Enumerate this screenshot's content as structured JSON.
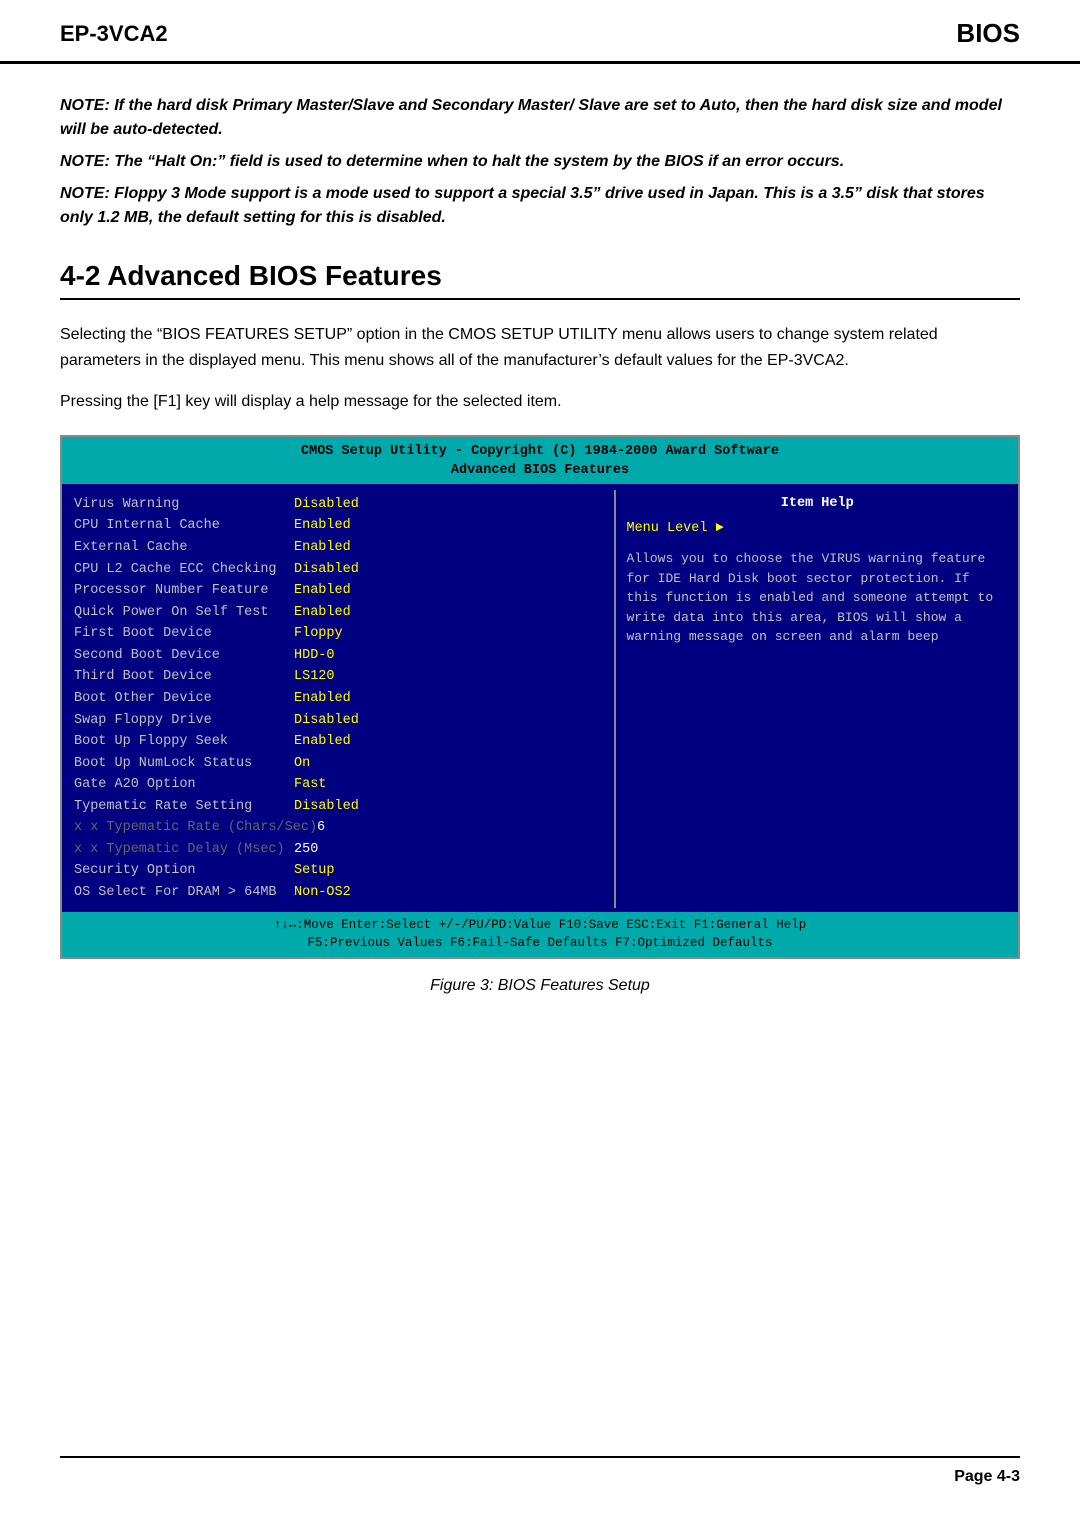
{
  "header": {
    "left": "EP-3VCA2",
    "right": "BIOS"
  },
  "notes": [
    "NOTE: If the hard disk Primary Master/Slave and Secondary Master/ Slave are set to Auto, then the hard disk size and model will be auto-detected.",
    "NOTE: The “Halt On:” field is used to determine when to halt the system by the BIOS if an error occurs.",
    "NOTE:  Floppy 3 Mode support is a mode used to support a special 3.5” drive used in Japan.  This is a 3.5” disk that stores only 1.2 MB, the default setting for this is disabled."
  ],
  "section_heading": "4-2 Advanced BIOS Features",
  "body_paragraphs": [
    "Selecting the “BIOS FEATURES SETUP” option in the CMOS SETUP UTILITY menu allows users to change system related parameters in the displayed menu. This menu shows all  of the manufacturer’s default values for the  EP-3VCA2.",
    "Pressing the [F1] key will display a help message for the selected item."
  ],
  "bios": {
    "title_line1": "CMOS Setup Utility - Copyright (C) 1984-2000 Award Software",
    "title_line2": "Advanced BIOS Features",
    "rows": [
      {
        "label": "Virus Warning",
        "value": "Disabled",
        "color": "yellow",
        "dim": false
      },
      {
        "label": "CPU Internal Cache",
        "value": "Enabled",
        "color": "yellow",
        "dim": false
      },
      {
        "label": "External Cache",
        "value": "Enabled",
        "color": "yellow",
        "dim": false
      },
      {
        "label": "CPU L2 Cache ECC Checking",
        "value": "Disabled",
        "color": "yellow",
        "dim": false
      },
      {
        "label": "Processor Number Feature",
        "value": "Enabled",
        "color": "yellow",
        "dim": false
      },
      {
        "label": "Quick Power On Self Test",
        "value": "Enabled",
        "color": "yellow",
        "dim": false
      },
      {
        "label": "First Boot Device",
        "value": "Floppy",
        "color": "yellow",
        "dim": false
      },
      {
        "label": "Second Boot Device",
        "value": "HDD-0",
        "color": "yellow",
        "dim": false
      },
      {
        "label": "Third Boot Device",
        "value": "LS120",
        "color": "yellow",
        "dim": false
      },
      {
        "label": "Boot Other Device",
        "value": "Enabled",
        "color": "yellow",
        "dim": false
      },
      {
        "label": "Swap Floppy Drive",
        "value": "Disabled",
        "color": "yellow",
        "dim": false
      },
      {
        "label": "Boot Up Floppy Seek",
        "value": "Enabled",
        "color": "yellow",
        "dim": false
      },
      {
        "label": "Boot Up NumLock Status",
        "value": "On",
        "color": "yellow",
        "dim": false
      },
      {
        "label": "Gate A20 Option",
        "value": "Fast",
        "color": "yellow",
        "dim": false
      },
      {
        "label": "Typematic Rate Setting",
        "value": "Disabled",
        "color": "yellow",
        "dim": false
      },
      {
        "label": "x Typematic Rate (Chars/Sec)",
        "value": "6",
        "color": "white",
        "dim": true
      },
      {
        "label": "x Typematic Delay (Msec)",
        "value": "250",
        "color": "white",
        "dim": true
      },
      {
        "label": "Security Option",
        "value": "Setup",
        "color": "yellow",
        "dim": false
      },
      {
        "label": "OS Select For DRAM > 64MB",
        "value": "Non-OS2",
        "color": "yellow",
        "dim": false
      }
    ],
    "item_help_title": "Item Help",
    "menu_level_label": "Menu Level",
    "help_text": "Allows you to choose the VIRUS warning feature for IDE Hard Disk boot sector protection. If this function is enabled and someone attempt to write data into this area, BIOS will show a warning message on screen and alarm beep",
    "footer_line1": "↑↓↔:Move  Enter:Select  +/-/PU/PD:Value  F10:Save  ESC:Exit  F1:General Help",
    "footer_line2": "F5:Previous Values    F6:Fail-Safe Defaults    F7:Optimized Defaults"
  },
  "figure_caption": "Figure 3:  BIOS Features Setup",
  "footer": {
    "page_label": "Page 4-3"
  }
}
